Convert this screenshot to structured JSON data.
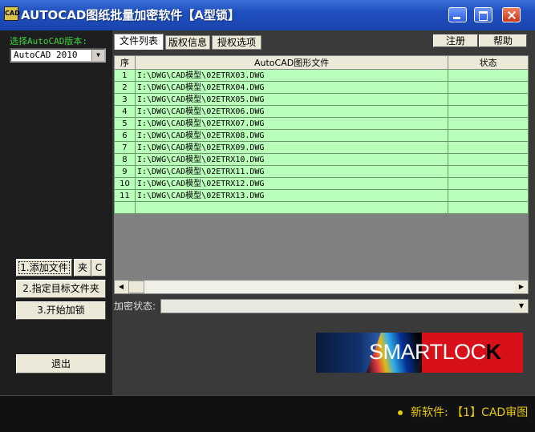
{
  "window": {
    "title": "AUTOCAD图纸批量加密软件【A型锁】",
    "app_icon": "CAD"
  },
  "left": {
    "version_label": "选择AutoCAD版本:",
    "version_selected": "AutoCAD 2010",
    "btn_add_files": "1.添加文件",
    "btn_folder": "夹",
    "btn_c": "C",
    "btn_target_folder": "2.指定目标文件夹",
    "btn_start": "3.开始加锁",
    "btn_exit": "退出"
  },
  "tabs": [
    {
      "label": "文件列表",
      "active": true
    },
    {
      "label": "版权信息",
      "active": false
    },
    {
      "label": "授权选项",
      "active": false
    }
  ],
  "top_buttons": {
    "register": "注册",
    "help": "帮助"
  },
  "table": {
    "columns": [
      "序",
      "AutoCAD图形文件",
      "状态"
    ],
    "rows": [
      {
        "index": "1",
        "file": "I:\\DWG\\CAD模型\\02ETRX03.DWG",
        "status": ""
      },
      {
        "index": "2",
        "file": "I:\\DWG\\CAD模型\\02ETRX04.DWG",
        "status": ""
      },
      {
        "index": "3",
        "file": "I:\\DWG\\CAD模型\\02ETRX05.DWG",
        "status": ""
      },
      {
        "index": "4",
        "file": "I:\\DWG\\CAD模型\\02ETRX06.DWG",
        "status": ""
      },
      {
        "index": "5",
        "file": "I:\\DWG\\CAD模型\\02ETRX07.DWG",
        "status": ""
      },
      {
        "index": "6",
        "file": "I:\\DWG\\CAD模型\\02ETRX08.DWG",
        "status": ""
      },
      {
        "index": "7",
        "file": "I:\\DWG\\CAD模型\\02ETRX09.DWG",
        "status": ""
      },
      {
        "index": "8",
        "file": "I:\\DWG\\CAD模型\\02ETRX10.DWG",
        "status": ""
      },
      {
        "index": "9",
        "file": "I:\\DWG\\CAD模型\\02ETRX11.DWG",
        "status": ""
      },
      {
        "index": "10",
        "file": "I:\\DWG\\CAD模型\\02ETRX12.DWG",
        "status": ""
      },
      {
        "index": "11",
        "file": "I:\\DWG\\CAD模型\\02ETRX13.DWG",
        "status": ""
      }
    ]
  },
  "encrypt_status_label": "加密状态:",
  "logo": {
    "text_white": "SMARTLOC",
    "text_red": "K"
  },
  "footer": {
    "news": "新软件: 【1】CAD审图"
  },
  "colors": {
    "row_bg": "#b9ffb9",
    "accent_green": "#3fd23f",
    "news_yellow": "#e8c800",
    "logo_red": "#d8101a"
  }
}
